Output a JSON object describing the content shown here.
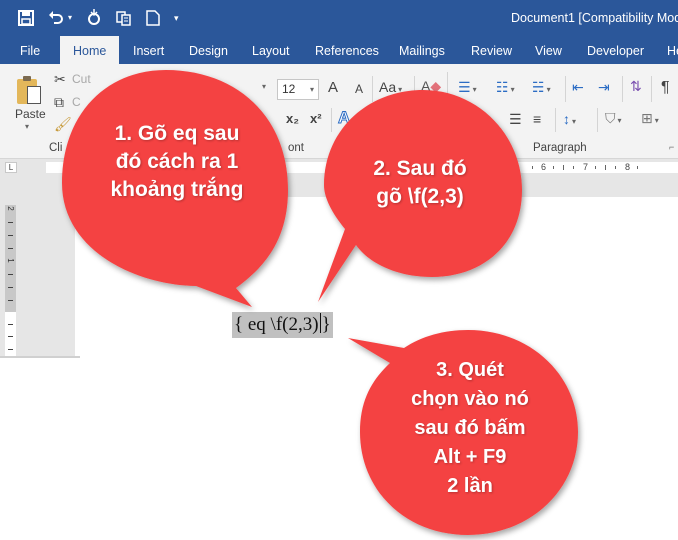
{
  "window": {
    "document_title": "Document1 [Compatibility Mod"
  },
  "quick_access": {
    "items": [
      {
        "name": "save",
        "glyph": "💾"
      },
      {
        "name": "undo",
        "glyph": "↶"
      },
      {
        "name": "redo",
        "glyph": "↻"
      },
      {
        "name": "paste-copy",
        "glyph": "⧉"
      },
      {
        "name": "new-document",
        "glyph": "🗋"
      },
      {
        "name": "customize",
        "glyph": "⏷"
      }
    ]
  },
  "tabs": [
    "File",
    "Home",
    "Insert",
    "Design",
    "Layout",
    "References",
    "Mailings",
    "Review",
    "View",
    "Developer",
    "He"
  ],
  "active_tab": "Home",
  "ribbon": {
    "clipboard": {
      "paste_label": "Paste",
      "cut_label": "Cut",
      "copy_label": "C",
      "group_label": "Cli"
    },
    "font": {
      "size_value": "12",
      "grow_label": "A",
      "shrink_label": "A",
      "case_label": "Aa",
      "subscript_label": "x₂",
      "superscript_label": "x²",
      "group_label": "ont"
    },
    "paragraph": {
      "group_label": "Paragraph",
      "pilcrow": "¶"
    }
  },
  "ruler": {
    "corner_glyph": "L",
    "h_numbers": [
      "6",
      "7",
      "8"
    ],
    "v_numbers": [
      "2",
      "1"
    ]
  },
  "document": {
    "field_open": "{ eq \\f(2,3)",
    "field_close": "}"
  },
  "callouts": [
    {
      "lines": [
        "1. Gõ eq sau",
        "đó cách ra 1",
        "khoảng trắng"
      ]
    },
    {
      "lines": [
        "2. Sau đó",
        "gõ \\f(2,3)"
      ]
    },
    {
      "lines": [
        "3. Quét",
        "chọn vào nó",
        "sau đó bấm",
        "Alt + F9",
        "2 lần"
      ]
    }
  ],
  "colors": {
    "title_bar": "#2b579a",
    "ribbon_bg": "#f3f3f3",
    "callout_red": "#f44242",
    "field_highlight": "#c0c0c0"
  }
}
